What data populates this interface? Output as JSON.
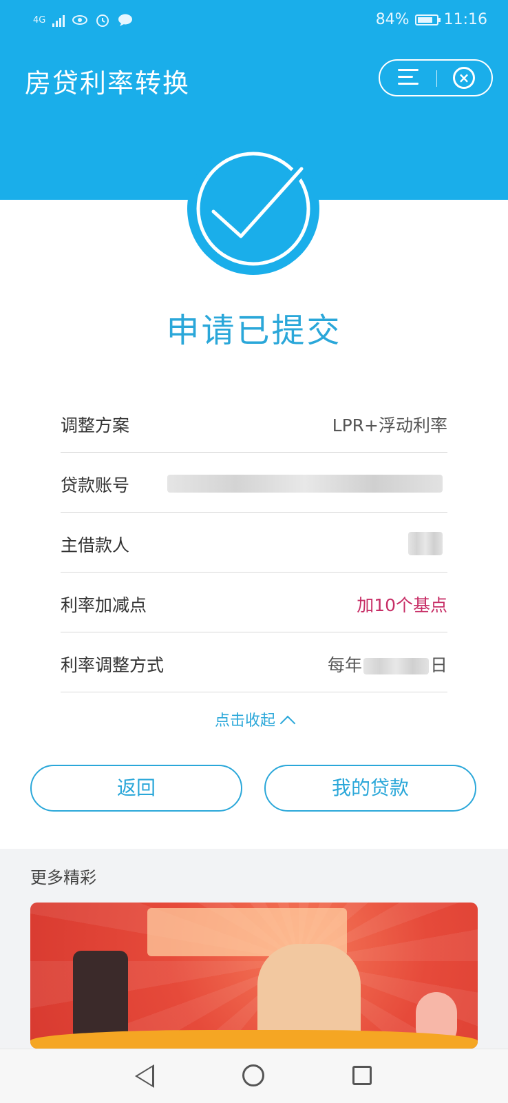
{
  "status_bar": {
    "network": "4G",
    "battery_percent": "84%",
    "battery_level": 0.84,
    "time": "11:16",
    "icons": [
      "signal-icon",
      "eye-icon",
      "alarm-icon",
      "message-icon",
      "battery-icon"
    ]
  },
  "header": {
    "title": "房贷利率转换",
    "menu_icon": "menu-icon",
    "close_icon": "close-icon"
  },
  "result": {
    "icon": "check-circle-icon",
    "title": "申请已提交"
  },
  "details": [
    {
      "label": "调整方案",
      "value": "LPR+浮动利率",
      "obscured": false
    },
    {
      "label": "贷款账号",
      "value": "",
      "obscured": true
    },
    {
      "label": "主借款人",
      "value": "",
      "obscured": true
    },
    {
      "label": "利率加减点",
      "value": "加10个基点",
      "obscured": false,
      "accent": true
    },
    {
      "label": "利率调整方式",
      "value_prefix": "每年",
      "value_suffix": "日",
      "obscured": true
    }
  ],
  "collapse_label": "点击收起",
  "buttons": {
    "back": "返回",
    "my_loans": "我的贷款"
  },
  "more": {
    "title": "更多精彩"
  },
  "colors": {
    "primary": "#1aaeea",
    "accent_text": "#2aa7d9",
    "highlight": "#c72e66",
    "banner": "#e64a3a"
  },
  "nav_bar": {
    "icons": [
      "nav-back-icon",
      "nav-home-icon",
      "nav-recent-icon"
    ]
  }
}
